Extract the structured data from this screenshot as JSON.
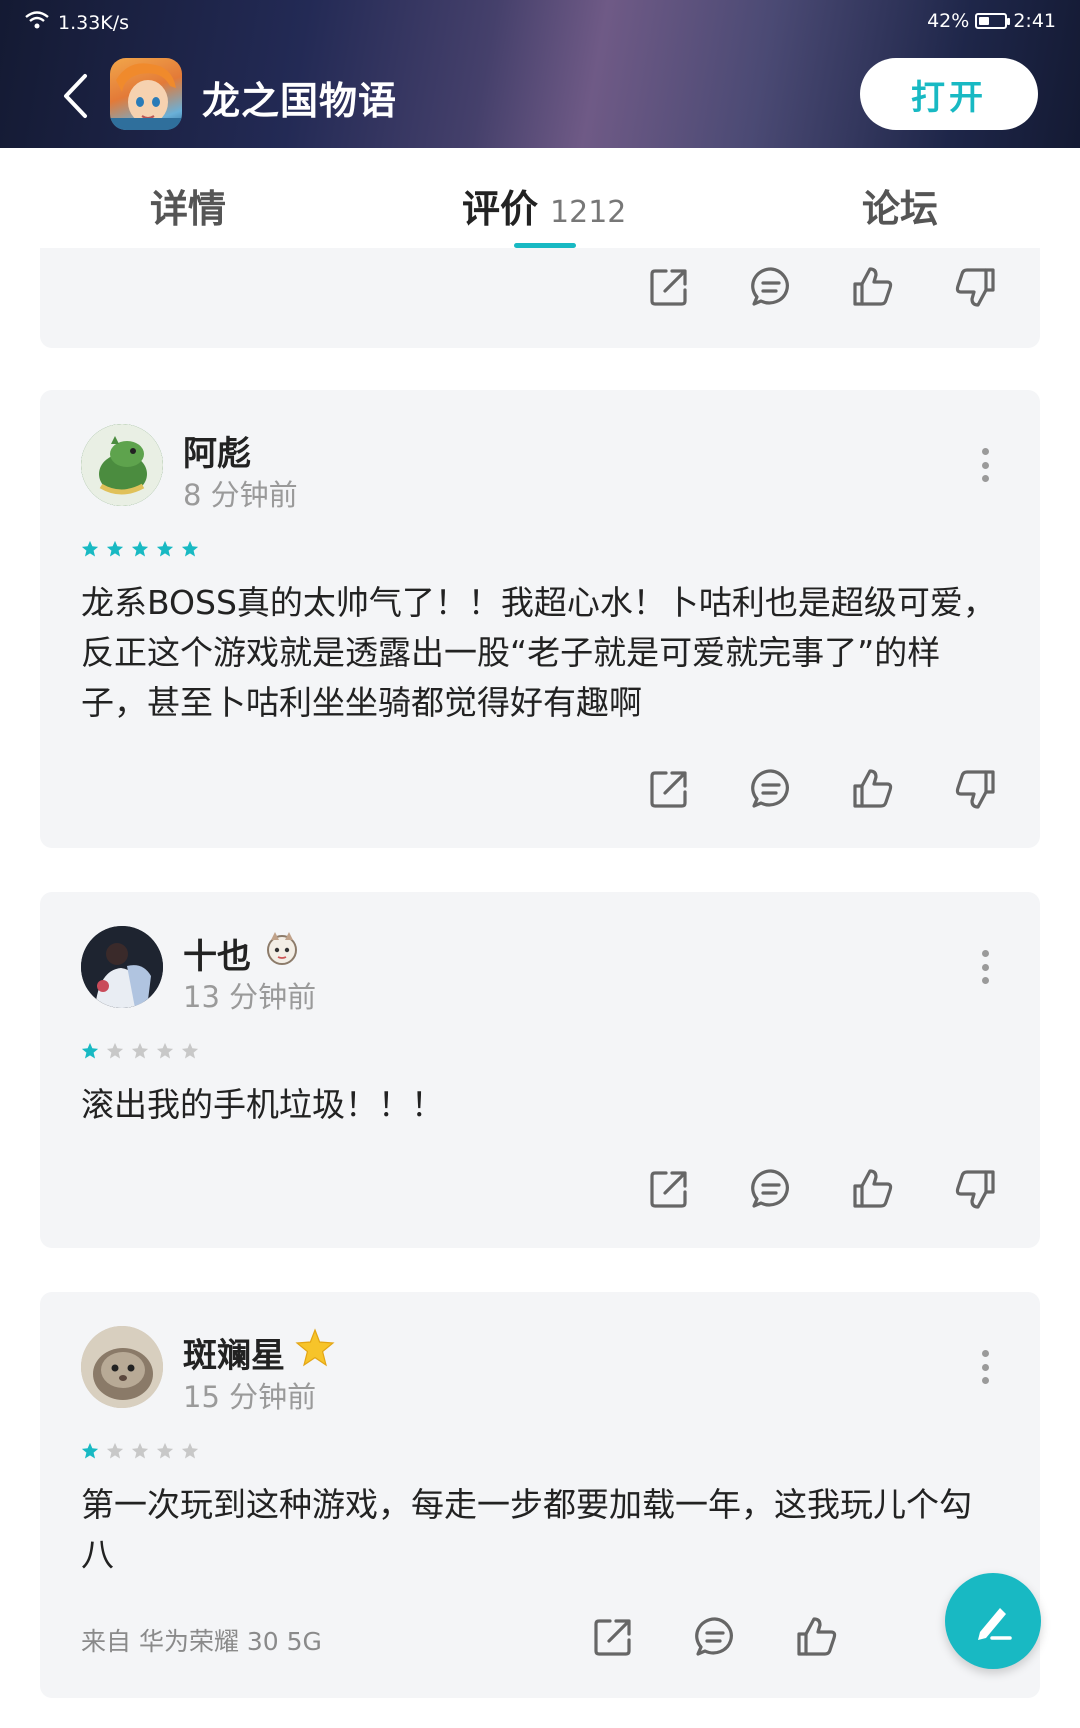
{
  "status_bar": {
    "network_speed": "1.33K/s",
    "battery_percent": "42%",
    "battery_level": 0.42,
    "time": "2:41"
  },
  "header": {
    "app_title": "龙之国物语",
    "open_button": "打开"
  },
  "tabs": [
    {
      "label": "详情"
    },
    {
      "label": "评价",
      "count": "1212",
      "active": true
    },
    {
      "label": "论坛"
    }
  ],
  "colors": {
    "accent": "#18b9c3",
    "card_bg": "#f4f5f7",
    "star_filled": "#18b9c3",
    "star_empty": "#c8c8c8"
  },
  "reviews": [
    {
      "username": "阿彪",
      "time": "8 分钟前",
      "rating": 5,
      "text": "龙系BOSS真的太帅气了！！我超心水！卜咕利也是超级可爱，反正这个游戏就是透露出一股“老子就是可爱就完事了”的样子，甚至卜咕利坐坐骑都觉得好有趣啊"
    },
    {
      "username": "十也",
      "time": "13 分钟前",
      "rating": 1,
      "text": "滚出我的手机垃圾！！！"
    },
    {
      "username": "斑斓星",
      "time": "15 分钟前",
      "rating": 1,
      "text": "第一次玩到这种游戏，每走一步都要加载一年，这我玩儿个勾八",
      "device": "来自 华为荣耀 30 5G"
    }
  ],
  "icons": {
    "share": "share-icon",
    "comment": "comment-icon",
    "like": "thumbs-up-icon",
    "dislike": "thumbs-down-icon",
    "more": "more-vertical-icon",
    "write": "pen-icon"
  }
}
